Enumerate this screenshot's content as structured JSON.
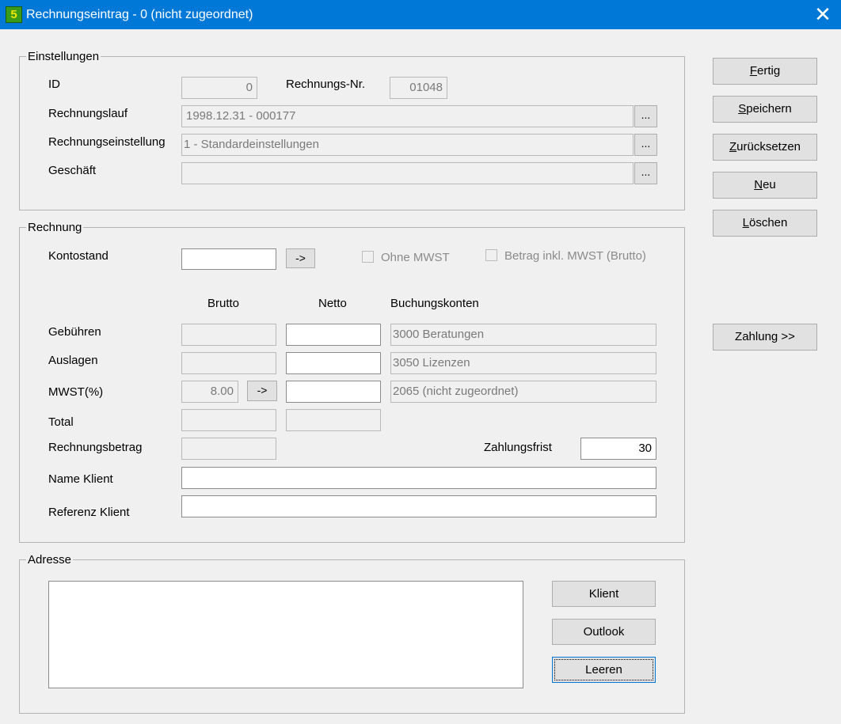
{
  "window": {
    "icon_label": "5",
    "title": "Rechnungseintrag - 0 (nicht zugeordnet)",
    "close_label": "✕"
  },
  "einstellungen": {
    "group_label": "Einstellungen",
    "id_label": "ID",
    "id_value": "0",
    "rechnungs_nr_label": "Rechnungs-Nr.",
    "rechnungs_nr_value": "01048",
    "rechnungslauf_label": "Rechnungslauf",
    "rechnungslauf_value": "1998.12.31 - 000177",
    "rechnungseinstellung_label": "Rechnungseinstellung",
    "rechnungseinstellung_value": "1 -  Standardeinstellungen",
    "geschaeft_label": "Geschäft",
    "geschaeft_value": "",
    "browse_label": "..."
  },
  "rechnung": {
    "group_label": "Rechnung",
    "kontostand_label": "Kontostand",
    "kontostand_value": "",
    "arrow_label": "->",
    "ohne_mwst_label": "Ohne MWST",
    "betrag_inkl_label": "Betrag inkl. MWST (Brutto)",
    "col_brutto": "Brutto",
    "col_netto": "Netto",
    "col_konten": "Buchungskonten",
    "gebuehren_label": "Gebühren",
    "gebuehren_brutto": "",
    "gebuehren_netto": "",
    "gebuehren_konto": "3000  Beratungen",
    "auslagen_label": "Auslagen",
    "auslagen_brutto": "",
    "auslagen_netto": "",
    "auslagen_konto": "3050  Lizenzen",
    "mwst_label": "MWST(%)",
    "mwst_value": "8.00",
    "mwst_netto": "",
    "mwst_konto": "2065  (nicht zugeordnet)",
    "total_label": "Total",
    "total_brutto": "",
    "total_netto": "",
    "rechnungsbetrag_label": "Rechnungsbetrag",
    "rechnungsbetrag_value": "",
    "zahlungsfrist_label": "Zahlungsfrist",
    "zahlungsfrist_value": "30",
    "name_klient_label": "Name Klient",
    "name_klient_value": "",
    "referenz_klient_label": "Referenz Klient",
    "referenz_klient_value": ""
  },
  "adresse": {
    "group_label": "Adresse",
    "address_text": "",
    "klient_button": "Klient",
    "outlook_button": "Outlook",
    "leeren_button": "Leeren"
  },
  "actions": {
    "fertig_key": "F",
    "fertig_rest": "ertig",
    "speichern_key": "S",
    "speichern_rest": "peichern",
    "zuruecksetzen_key": "Z",
    "zuruecksetzen_rest": "urücksetzen",
    "neu_key": "N",
    "neu_rest": "eu",
    "loeschen_key": "L",
    "loeschen_rest": "öschen",
    "zahlung_label": "Zahlung >>"
  },
  "colors": {
    "titlebar": "#0078d7",
    "window_bg": "#f0f0f0",
    "button_bg": "#e1e1e1"
  }
}
